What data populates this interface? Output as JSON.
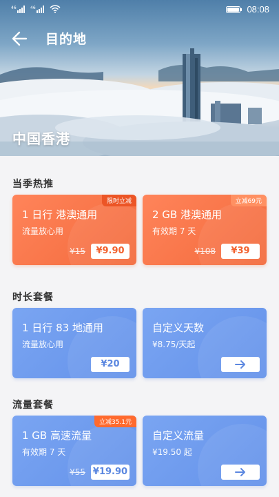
{
  "status_bar": {
    "time": "08:08",
    "signal1": "⁴⁶",
    "signal2": "⁴⁶"
  },
  "header": {
    "title": "目的地",
    "destination": "中国香港"
  },
  "colors": {
    "orange": "#f36a3c",
    "blue": "#6492ea",
    "white": "#ffffff"
  },
  "sections": [
    {
      "title": "当季热推",
      "cards": [
        {
          "name": "1 日行  港澳通用",
          "sub": "流量放心用",
          "tag": "限时立减",
          "original_price": "¥15",
          "price": "¥9.90"
        },
        {
          "name": "2 GB 港澳通用",
          "sub": "有效期 7 天",
          "tag": "立减69元",
          "original_price": "¥108",
          "price": "¥39"
        }
      ]
    },
    {
      "title": "时长套餐",
      "cards": [
        {
          "name": "1 日行  83 地通用",
          "sub": "流量放心用",
          "price": "¥20"
        },
        {
          "name": "自定义天数",
          "sub": "¥8.75/天起",
          "action_icon": "arrow-right-icon"
        }
      ]
    },
    {
      "title": "流量套餐",
      "cards": [
        {
          "name": "1 GB 高速流量",
          "sub": "有效期 7 天",
          "tag": "立减35.1元",
          "original_price": "¥55",
          "price": "¥19.90"
        },
        {
          "name": "自定义流量",
          "sub": "¥19.50 起",
          "action_icon": "arrow-right-icon"
        }
      ]
    }
  ]
}
